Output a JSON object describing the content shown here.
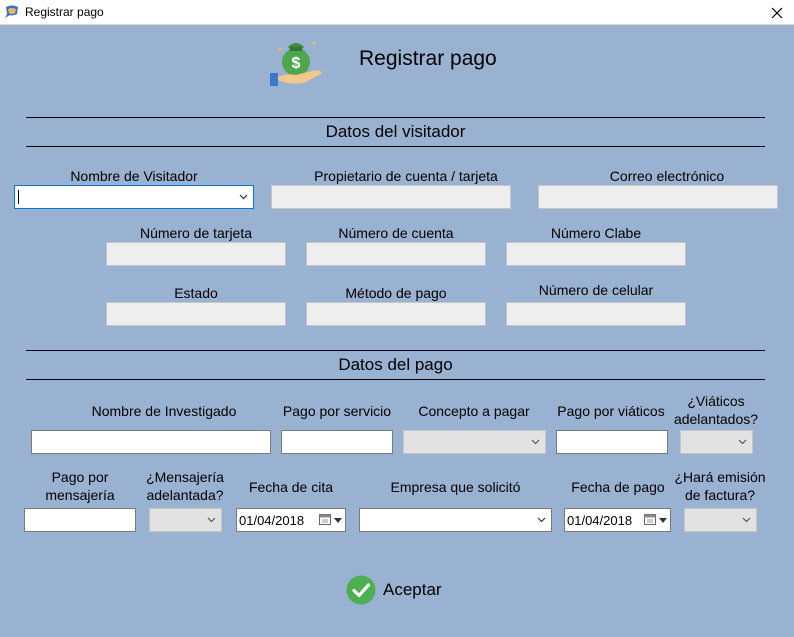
{
  "window": {
    "title": "Registrar pago"
  },
  "header": {
    "title": "Registrar pago"
  },
  "visitor_section": {
    "title": "Datos del visitador",
    "nombre_visitador": {
      "label": "Nombre de Visitador",
      "value": ""
    },
    "propietario": {
      "label": "Propietario de cuenta / tarjeta",
      "value": ""
    },
    "correo": {
      "label": "Correo electrónico",
      "value": ""
    },
    "numero_tarjeta": {
      "label": "Número de tarjeta",
      "value": ""
    },
    "numero_cuenta": {
      "label": "Número de cuenta",
      "value": ""
    },
    "numero_clabe": {
      "label": "Número Clabe",
      "value": ""
    },
    "estado": {
      "label": "Estado",
      "value": ""
    },
    "metodo_pago": {
      "label": "Método de pago",
      "value": ""
    },
    "numero_celular": {
      "label": "Número de celular",
      "value": ""
    }
  },
  "payment_section": {
    "title": "Datos del pago",
    "nombre_investigado": {
      "label": "Nombre de Investigado",
      "value": ""
    },
    "pago_servicio": {
      "label": "Pago por servicio",
      "value": ""
    },
    "concepto": {
      "label": "Concepto a pagar",
      "value": ""
    },
    "pago_viaticos": {
      "label": "Pago por viáticos",
      "value": ""
    },
    "viaticos_adelantados": {
      "label_line1": "¿Viáticos",
      "label_line2": "adelantados?",
      "value": ""
    },
    "pago_mensajeria": {
      "label_line1": "Pago por",
      "label_line2": "mensajería",
      "value": ""
    },
    "mensajeria_adelantada": {
      "label_line1": "¿Mensajería",
      "label_line2": "adelantada?",
      "value": ""
    },
    "fecha_cita": {
      "label": "Fecha de cita",
      "value": "01/04/2018"
    },
    "empresa": {
      "label": "Empresa que solicitó",
      "value": ""
    },
    "fecha_pago": {
      "label": "Fecha de pago",
      "value": "01/04/2018"
    },
    "emision_factura": {
      "label_line1": "¿Hará emisión",
      "label_line2": "de factura?",
      "value": ""
    }
  },
  "actions": {
    "accept_label": "Aceptar"
  },
  "colors": {
    "background": "#9ab2d1",
    "field_disabled": "#eeeeee",
    "focus_border": "#0078d7",
    "check_green": "#4caf50"
  }
}
